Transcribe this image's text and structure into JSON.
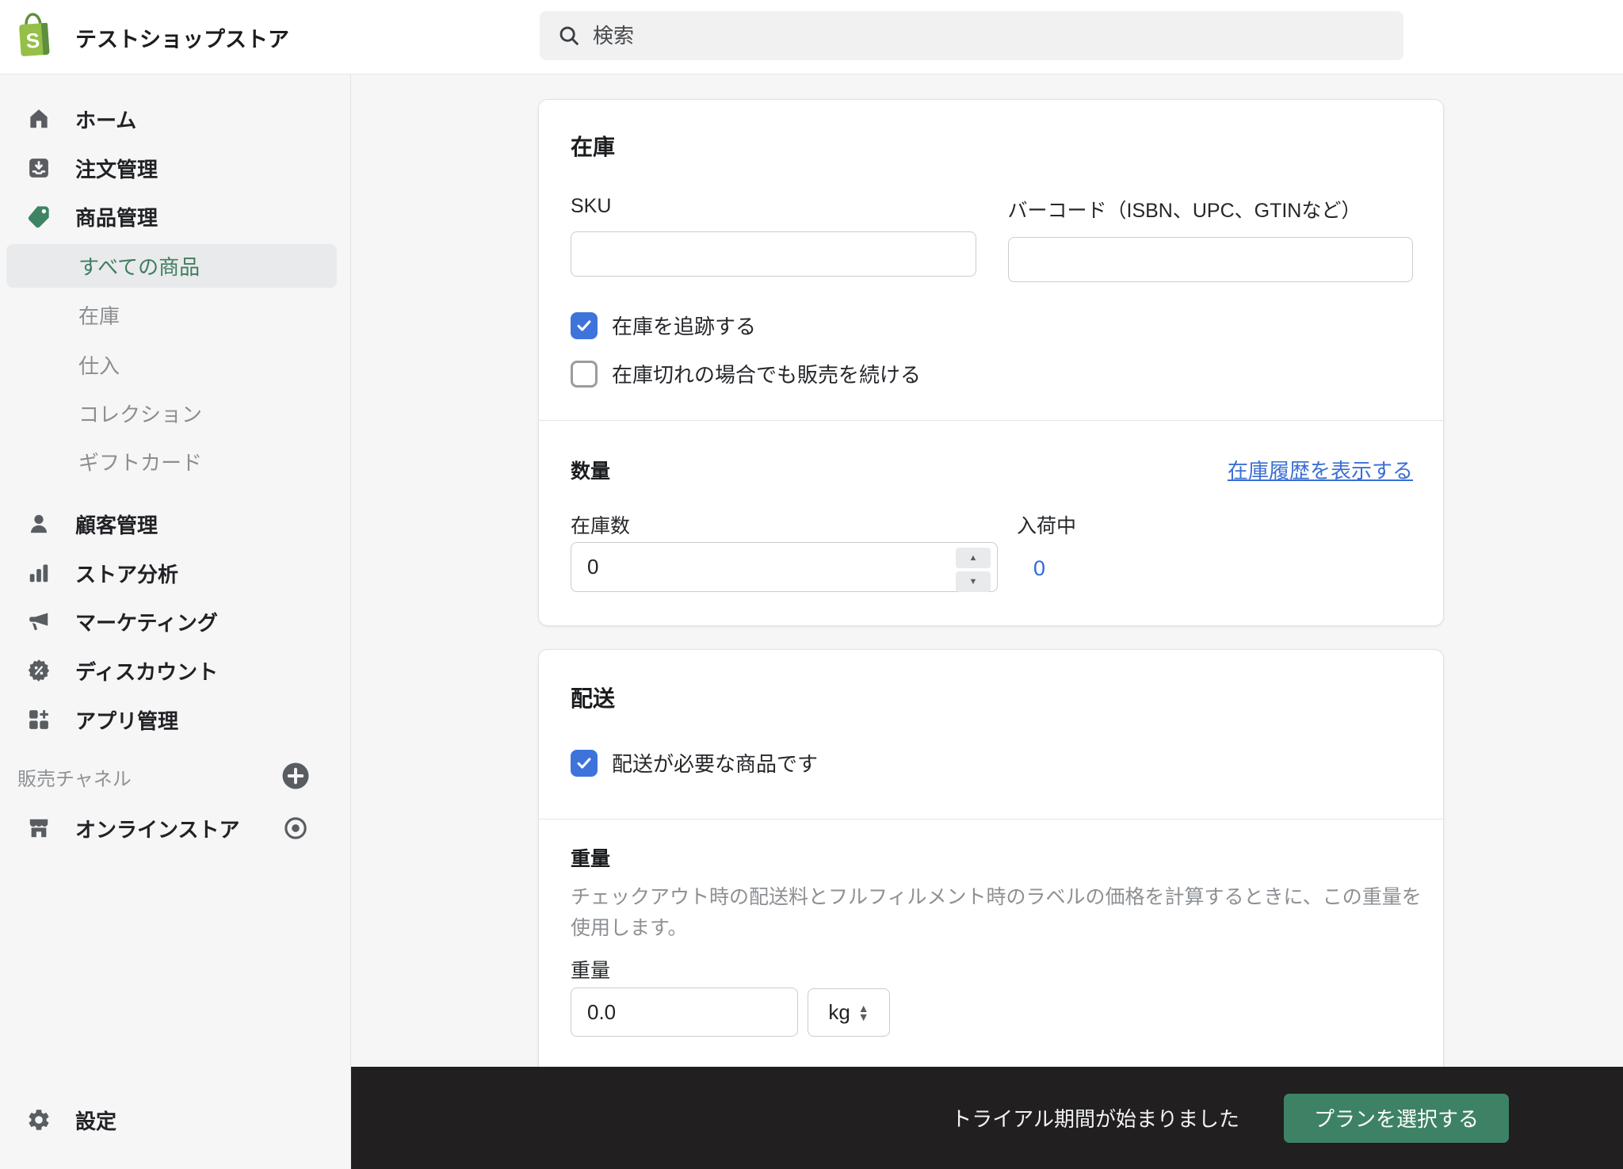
{
  "header": {
    "store_name": "テストショップストア",
    "search_placeholder": "検索"
  },
  "sidebar": {
    "main_items": [
      {
        "label": "ホーム",
        "icon": "home-icon"
      },
      {
        "label": "注文管理",
        "icon": "orders-icon"
      },
      {
        "label": "商品管理",
        "icon": "products-tag-icon"
      }
    ],
    "product_sub_items": [
      {
        "label": "すべての商品",
        "active": true
      },
      {
        "label": "在庫",
        "active": false
      },
      {
        "label": "仕入",
        "active": false
      },
      {
        "label": "コレクション",
        "active": false
      },
      {
        "label": "ギフトカード",
        "active": false
      }
    ],
    "secondary_items": [
      {
        "label": "顧客管理",
        "icon": "customers-icon"
      },
      {
        "label": "ストア分析",
        "icon": "analytics-icon"
      },
      {
        "label": "マーケティング",
        "icon": "marketing-icon"
      },
      {
        "label": "ディスカウント",
        "icon": "discounts-icon"
      },
      {
        "label": "アプリ管理",
        "icon": "apps-icon"
      }
    ],
    "sales_channel_header": "販売チャネル",
    "online_store_label": "オンラインストア",
    "settings_label": "設定"
  },
  "inventory_card": {
    "title": "在庫",
    "sku_label": "SKU",
    "sku_value": "",
    "barcode_label": "バーコード（ISBN、UPC、GTINなど）",
    "barcode_value": "",
    "track_inventory_label": "在庫を追跡する",
    "track_inventory_checked": true,
    "continue_selling_label": "在庫切れの場合でも販売を続ける",
    "continue_selling_checked": false,
    "quantity": {
      "title": "数量",
      "history_link": "在庫履歴を表示する",
      "available_label": "在庫数",
      "available_value": "0",
      "incoming_label": "入荷中",
      "incoming_value": "0"
    }
  },
  "shipping_card": {
    "title": "配送",
    "physical_product_label": "配送が必要な商品です",
    "physical_product_checked": true,
    "weight": {
      "title": "重量",
      "description": "チェックアウト時の配送料とフルフィルメント時のラベルの価格を計算するときに、この重量を使用します。",
      "label": "重量",
      "value": "0.0",
      "unit": "kg"
    }
  },
  "footer": {
    "trial_message": "トライアル期間が始まりました",
    "plan_button_label": "プランを選択する"
  },
  "colors": {
    "brand_green": "#95bf47",
    "brand_green_dark": "#5e8e3e",
    "nav_active_green": "#3e7d60",
    "tag_icon_green": "#3e8463",
    "checkbox_blue": "#3e73db",
    "link_blue": "#3b6fd4",
    "footer_bg": "#211f20",
    "plan_button_green": "#3e8266",
    "sidebar_bg": "#f6f6f7"
  }
}
